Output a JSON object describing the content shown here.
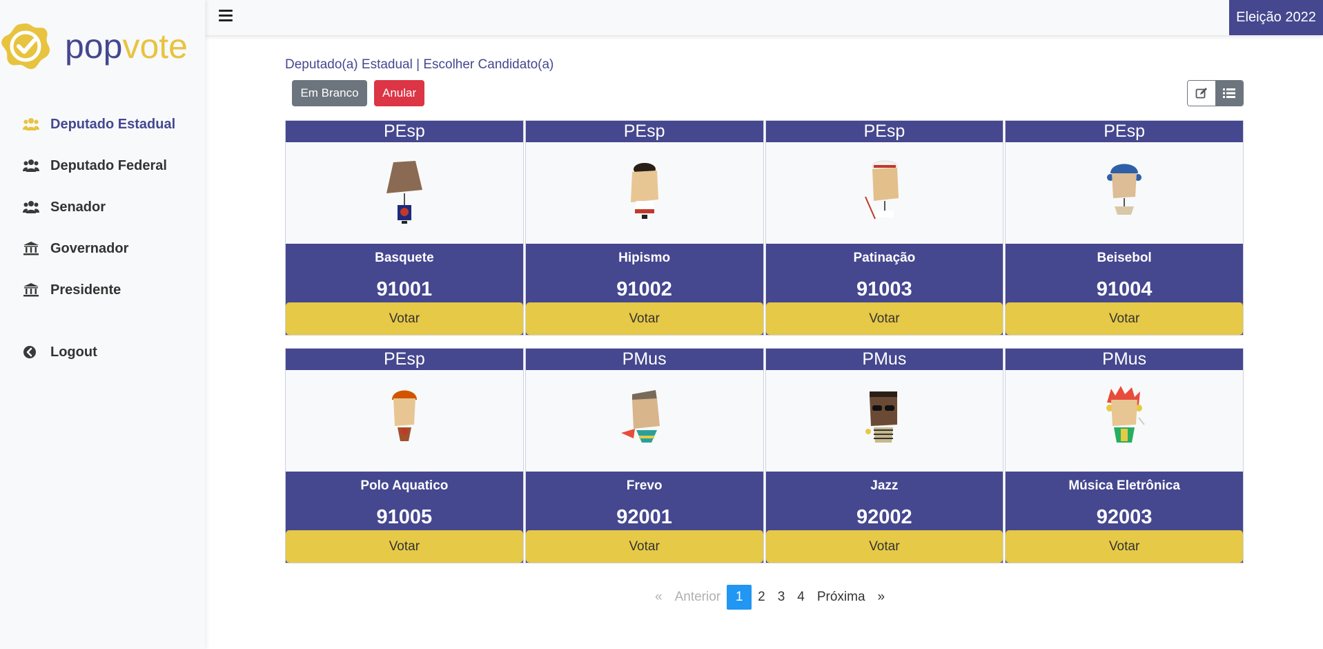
{
  "brand": {
    "name_part1": "pop",
    "name_part2": "vote",
    "primary_color": "#45478f",
    "accent_color": "#e8c33f"
  },
  "sidebar": {
    "items": [
      {
        "label": "Deputado Estadual",
        "icon": "users-icon",
        "active": true
      },
      {
        "label": "Deputado Federal",
        "icon": "users-icon",
        "active": false
      },
      {
        "label": "Senador",
        "icon": "users-icon",
        "active": false
      },
      {
        "label": "Governador",
        "icon": "institution-icon",
        "active": false
      },
      {
        "label": "Presidente",
        "icon": "institution-icon",
        "active": false
      }
    ],
    "logout_label": "Logout"
  },
  "topbar": {
    "menu_icon": "hamburger-icon",
    "election_label": "Eleição 2022"
  },
  "main": {
    "breadcrumb": "Deputado(a) Estadual | Escolher Candidato(a)",
    "blank_button": "Em Branco",
    "null_button": "Anular",
    "view_edit_icon": "edit-icon",
    "view_list_icon": "list-icon"
  },
  "candidates": [
    {
      "party": "PEsp",
      "name": "Basquete",
      "number": "91001",
      "vote_label": "Votar"
    },
    {
      "party": "PEsp",
      "name": "Hipismo",
      "number": "91002",
      "vote_label": "Votar"
    },
    {
      "party": "PEsp",
      "name": "Patinação",
      "number": "91003",
      "vote_label": "Votar"
    },
    {
      "party": "PEsp",
      "name": "Beisebol",
      "number": "91004",
      "vote_label": "Votar"
    },
    {
      "party": "PEsp",
      "name": "Polo Aquatico",
      "number": "91005",
      "vote_label": "Votar"
    },
    {
      "party": "PMus",
      "name": "Frevo",
      "number": "92001",
      "vote_label": "Votar"
    },
    {
      "party": "PMus",
      "name": "Jazz",
      "number": "92002",
      "vote_label": "Votar"
    },
    {
      "party": "PMus",
      "name": "Música Eletrônica",
      "number": "92003",
      "vote_label": "Votar"
    }
  ],
  "pagination": {
    "prev_symbol": "«",
    "prev_label": "Anterior",
    "pages": [
      "1",
      "2",
      "3",
      "4"
    ],
    "current_page": "1",
    "next_label": "Próxima",
    "next_symbol": "»"
  }
}
